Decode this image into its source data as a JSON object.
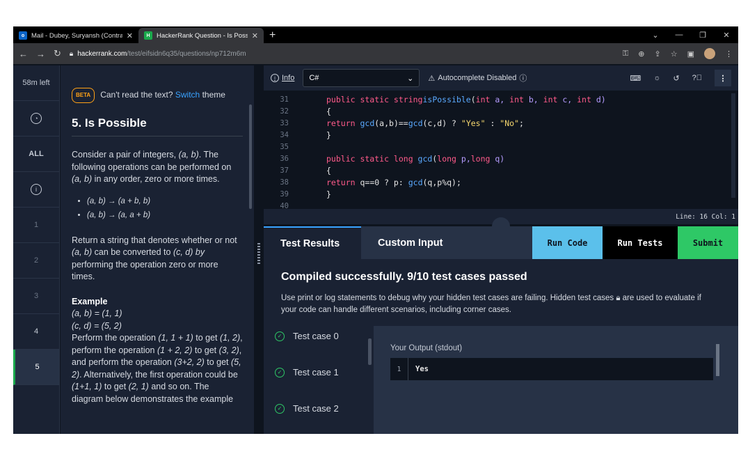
{
  "browser": {
    "tabs": [
      {
        "title": "Mail - Dubey, Suryansh (Contract",
        "favicon": "outlook-icon",
        "favicon_color": "#0a64c8"
      },
      {
        "title": "HackerRank Question - Is Possible",
        "favicon": "hackerrank-icon",
        "favicon_color": "#1ba94c"
      }
    ],
    "url_host": "hackerrank.com",
    "url_path": "/test/eifsidn6q35/questions/np712m6m"
  },
  "rail": {
    "timer": "58m left",
    "all_label": "ALL",
    "questions": [
      "1",
      "2",
      "3",
      "4",
      "5"
    ]
  },
  "problem": {
    "beta_badge": "BETA",
    "cant_read": "Can't read the text?",
    "switch_link": "Switch",
    "theme_word": "theme",
    "title": "5. Is Possible",
    "para1_a": "Consider a pair of integers, ",
    "para1_pair": "(a, b)",
    "para1_b": ". The following operations can be performed on ",
    "para1_c": " in any order, zero or more times.",
    "bullets": [
      "(a, b) → (a + b, b)",
      "(a, b) → (a, a + b)"
    ],
    "para2_a": "Return a string that denotes whether or not ",
    "para2_from": "(a, b)",
    "para2_b": " can be converted to ",
    "para2_to": "(c, d) by",
    "para2_c": " performing the operation zero or more times.",
    "example_heading": "Example",
    "ex_ab": "(a, b) = (1, 1)",
    "ex_cd": "(c, d) = (5, 2)",
    "ex_t1": "Perform the operation ",
    "ex_op1": "(1, 1 + 1)",
    "ex_t2": " to get ",
    "ex_r1": "(1, 2)",
    "ex_t3": ", perform the operation ",
    "ex_op2": "(1 + 2, 2)",
    "ex_t4": " to get ",
    "ex_r2": "(3, 2)",
    "ex_t5": ", and perform the operation ",
    "ex_op3": "(3+2, 2)",
    "ex_t6": " to get ",
    "ex_r3": "(5, 2)",
    "ex_t7": ". Alternatively, the first operation could be ",
    "ex_op4": "(1+1, 1)",
    "ex_t8": " to get ",
    "ex_r4": "(2, 1)",
    "ex_t9": " and so on. The diagram below demonstrates the example"
  },
  "editor": {
    "info_label": "Info",
    "language": "C#",
    "autocomplete": "Autocomplete Disabled",
    "status": "Line: 16 Col: 1",
    "lines": {
      "n31": "31",
      "n32": "32",
      "n33": "33",
      "n34": "34",
      "n35": "35",
      "n36": "36",
      "n37": "37",
      "n38": "38",
      "n39": "39",
      "n40": "40",
      "l31_kw": "public static string",
      "l31_fn": "isPossible",
      "l31_p1": "(",
      "l31_t1": "int",
      "l31_v1": " a, ",
      "l31_t2": "int",
      "l31_v2": " b, ",
      "l31_t3": "int",
      "l31_v3": " c, ",
      "l31_t4": "int",
      "l31_v4": " d)",
      "l32": "{",
      "l33_kw": "return",
      "l33_fn1": " gcd",
      "l33_a": "(a,b)==",
      "l33_fn2": "gcd",
      "l33_b": "(c,d) ? ",
      "l33_s1": "\"Yes\"",
      "l33_c": " : ",
      "l33_s2": "\"No\"",
      "l33_d": ";",
      "l34": "}",
      "l36_kw": "public static long",
      "l36_fn": " gcd",
      "l36_a": "(",
      "l36_t1": "long",
      "l36_v1": " p,",
      "l36_t2": "long",
      "l36_v2": " q)",
      "l37": "{",
      "l38_kw": "return",
      "l38_a": " q==0 ? p: ",
      "l38_fn": "gcd",
      "l38_b": "(q,p%q);",
      "l39": "}"
    }
  },
  "results": {
    "tab_results": "Test Results",
    "tab_custom": "Custom Input",
    "run_code": "Run Code",
    "run_tests": "Run Tests",
    "submit": "Submit",
    "headline": "Compiled successfully. 9/10 test cases passed",
    "desc_a": "Use print or log statements to debug why your hidden test cases are failing. Hidden test cases ",
    "desc_b": " are used to evaluate if your code can handle different scenarios, including corner cases.",
    "cases": [
      "Test case 0",
      "Test case 1",
      "Test case 2"
    ],
    "output_label": "Your Output (stdout)",
    "output_line_no": "1",
    "output_value": "Yes",
    "pass_color": "#2ec866",
    "accent_color": "#39a2ff"
  }
}
